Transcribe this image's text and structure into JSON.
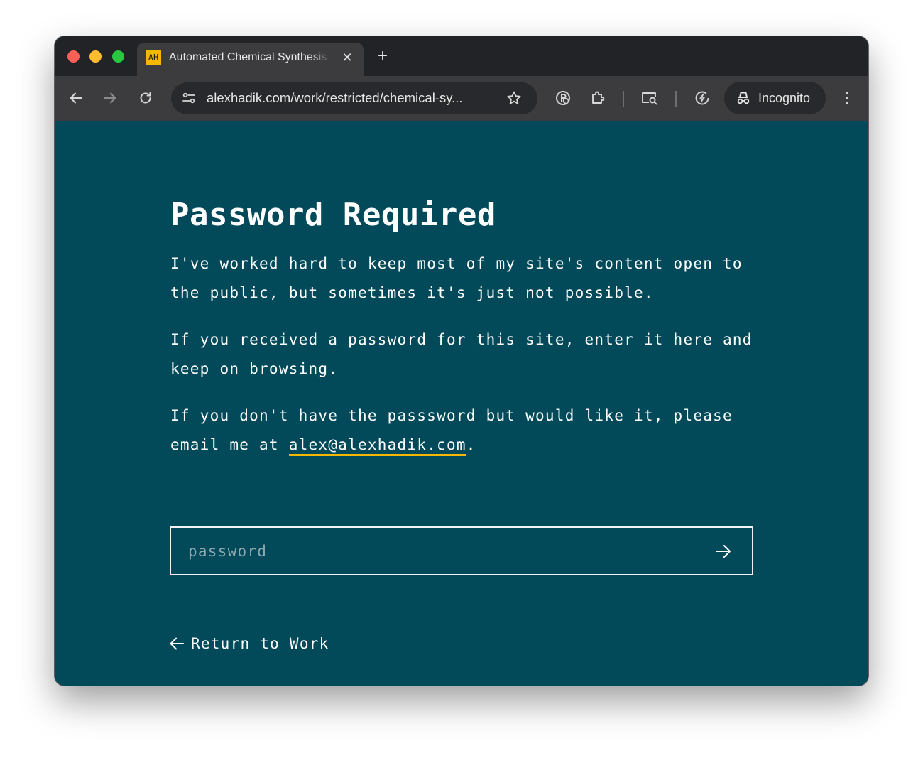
{
  "browser": {
    "tab": {
      "favicon_text": "AH",
      "title": "Automated Chemical Synthesis",
      "close_glyph": "✕"
    },
    "new_tab_glyph": "+",
    "toolbar": {
      "back_icon": "arrow-left-icon",
      "forward_icon": "arrow-right-icon",
      "reload_icon": "reload-icon",
      "url": "alexhadik.com/work/restricted/chemical-sy...",
      "bookmark_icon": "star-icon",
      "extension_icons": [
        "password-manager-icon",
        "puzzle-extensions-icon",
        "reader-mode-icon",
        "performance-icon"
      ],
      "incognito_label": "Incognito",
      "menu_icon": "kebab-menu-icon"
    },
    "colors": {
      "titlebar": "#222326",
      "toolbar": "#3c3c3f",
      "omnibox": "#28292c"
    }
  },
  "page": {
    "heading": "Password Required",
    "paragraph1": "I've worked hard to keep most of my site's content open to the public, but sometimes it's just not possible.",
    "paragraph2": "If you received a password for this site, enter it here and keep on browsing.",
    "paragraph3_prefix": "If you don't have the passsword but would like it, please email me at ",
    "email": "alex@alexhadik.com",
    "paragraph3_suffix": ".",
    "password_placeholder": "password",
    "password_value": "",
    "submit_icon": "arrow-right-icon",
    "return_icon": "arrow-left-icon",
    "return_label": "Return to Work",
    "colors": {
      "background": "#024a5a",
      "text": "#ffffff",
      "link_underline": "#f5b700"
    }
  }
}
